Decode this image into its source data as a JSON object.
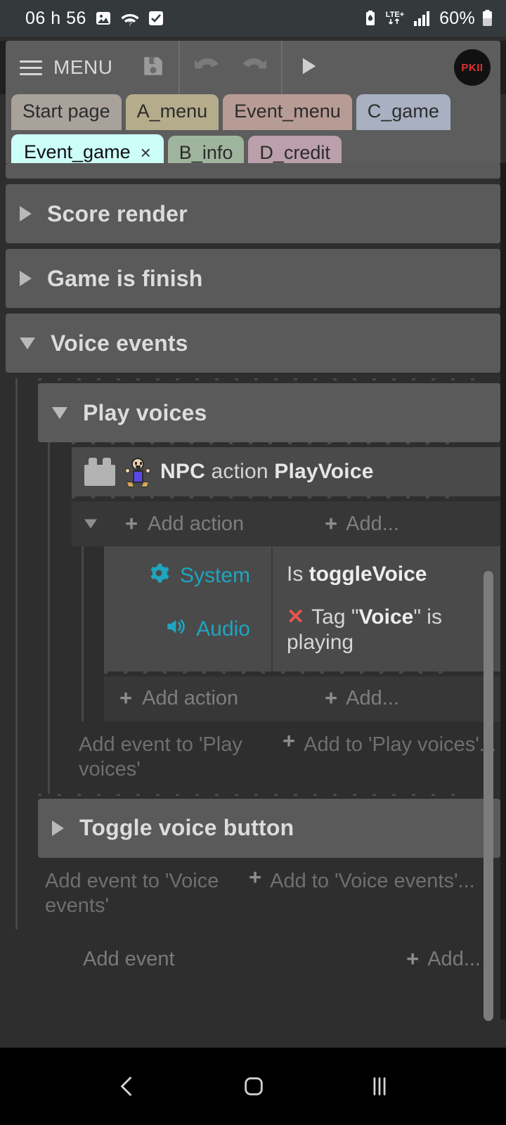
{
  "statusbar": {
    "time": "06 h 56",
    "left_icons": [
      "photo-icon",
      "wifi-question-icon",
      "checkbox-icon"
    ],
    "network_label": "LTE+",
    "battery_percent": "60%",
    "right_icons": [
      "battery-saver-icon",
      "lte-plus-icon",
      "signal-bars-icon",
      "battery-icon"
    ]
  },
  "toolbar": {
    "menu_label": "MENU",
    "icons": [
      "hamburger-icon",
      "save-icon",
      "undo-icon",
      "redo-icon",
      "play-icon"
    ],
    "logo_text": "PKII"
  },
  "tabs": {
    "row1": [
      {
        "label": "Start page",
        "color": "#a8a29b",
        "active": false
      },
      {
        "label": "A_menu",
        "color": "#b5ac8c",
        "active": false
      },
      {
        "label": "Event_menu",
        "color": "#b79b95",
        "active": false
      },
      {
        "label": "C_game",
        "color": "#a8b0c2",
        "active": false
      }
    ],
    "row2": [
      {
        "label": "Event_game",
        "color": "#ccfff8",
        "active": true,
        "close": "×"
      },
      {
        "label": "B_info",
        "color": "#9fb49d",
        "active": false
      },
      {
        "label": "D_credit",
        "color": "#bb9fab",
        "active": false
      }
    ]
  },
  "sheet": {
    "groups": [
      {
        "name": "Score render",
        "expanded": false
      },
      {
        "name": "Game is finish",
        "expanded": false
      },
      {
        "name": "Voice events",
        "expanded": true
      }
    ],
    "subgroup": {
      "name": "Play voices",
      "expanded": true
    },
    "event": {
      "icons": [
        "block-icon",
        "npc-sprite-icon"
      ],
      "prefix": "NPC",
      "middle": " action ",
      "suffix": "PlayVoice"
    },
    "add_action_label": "Add action",
    "add_short_label": "Add...",
    "conditions": [
      {
        "object": "System",
        "icon": "gear-icon",
        "negated": false,
        "text_prefix": "Is ",
        "text_bold": "toggleVoice",
        "text_suffix": ""
      },
      {
        "object": "Audio",
        "icon": "speaker-icon",
        "negated": true,
        "text_prefix": "Tag \"",
        "text_bold": "Voice",
        "text_suffix": "\" is playing"
      }
    ],
    "hints": [
      {
        "left": "Add event to 'Play voices'",
        "right": "Add to 'Play voices'..."
      },
      {
        "left": "Add event to 'Voice events'",
        "right": "Add to 'Voice events'..."
      }
    ],
    "collapsed_group": {
      "name": "Toggle voice button",
      "expanded": false
    },
    "final": {
      "left": "Add event",
      "right": "Add..."
    }
  },
  "navbar": {
    "back_label": "back-icon",
    "home_label": "home-icon",
    "recents_label": "recents-icon"
  },
  "colors": {
    "accent_cyan": "#1fa5c0",
    "negate_red": "#e8554e",
    "logo_red": "#e03030",
    "active_tab": "#ccfff8"
  }
}
